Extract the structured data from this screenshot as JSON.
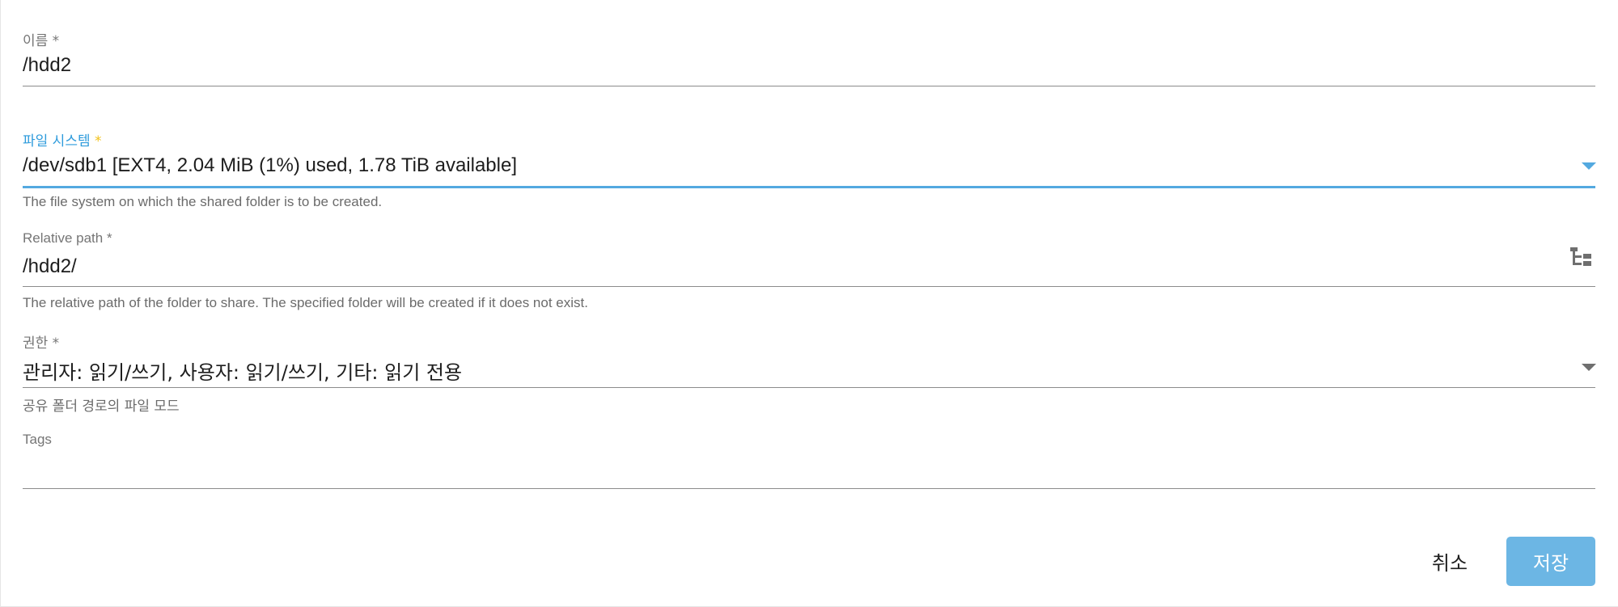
{
  "form": {
    "name_field": {
      "label": "이름",
      "required_mark": " *",
      "value": "/hdd2"
    },
    "filesystem_field": {
      "label": "파일 시스템",
      "required_mark": " *",
      "value": "/dev/sdb1 [EXT4, 2.04 MiB (1%) used, 1.78 TiB available]",
      "hint": "The file system on which the shared folder is to be created.",
      "icon": "chevron-down-icon"
    },
    "relative_path_field": {
      "label": "Relative path",
      "required_mark": " *",
      "value": "/hdd2/",
      "hint": "The relative path of the folder to share. The specified folder will be created if it does not exist.",
      "icon": "folder-tree-icon"
    },
    "permissions_field": {
      "label": "권한",
      "required_mark": " *",
      "value": "관리자: 읽기/쓰기, 사용자: 읽기/쓰기, 기타: 읽기 전용",
      "hint": "공유 폴더 경로의 파일 모드",
      "icon": "chevron-down-icon"
    },
    "tags_field": {
      "label": "Tags",
      "value": ""
    }
  },
  "actions": {
    "cancel_label": "취소",
    "save_label": "저장"
  },
  "colors": {
    "accent": "#53a9e0",
    "required_focused": "#f2c21b",
    "save_button_bg": "#6cb6e4",
    "underline": "#8c8c8c"
  }
}
